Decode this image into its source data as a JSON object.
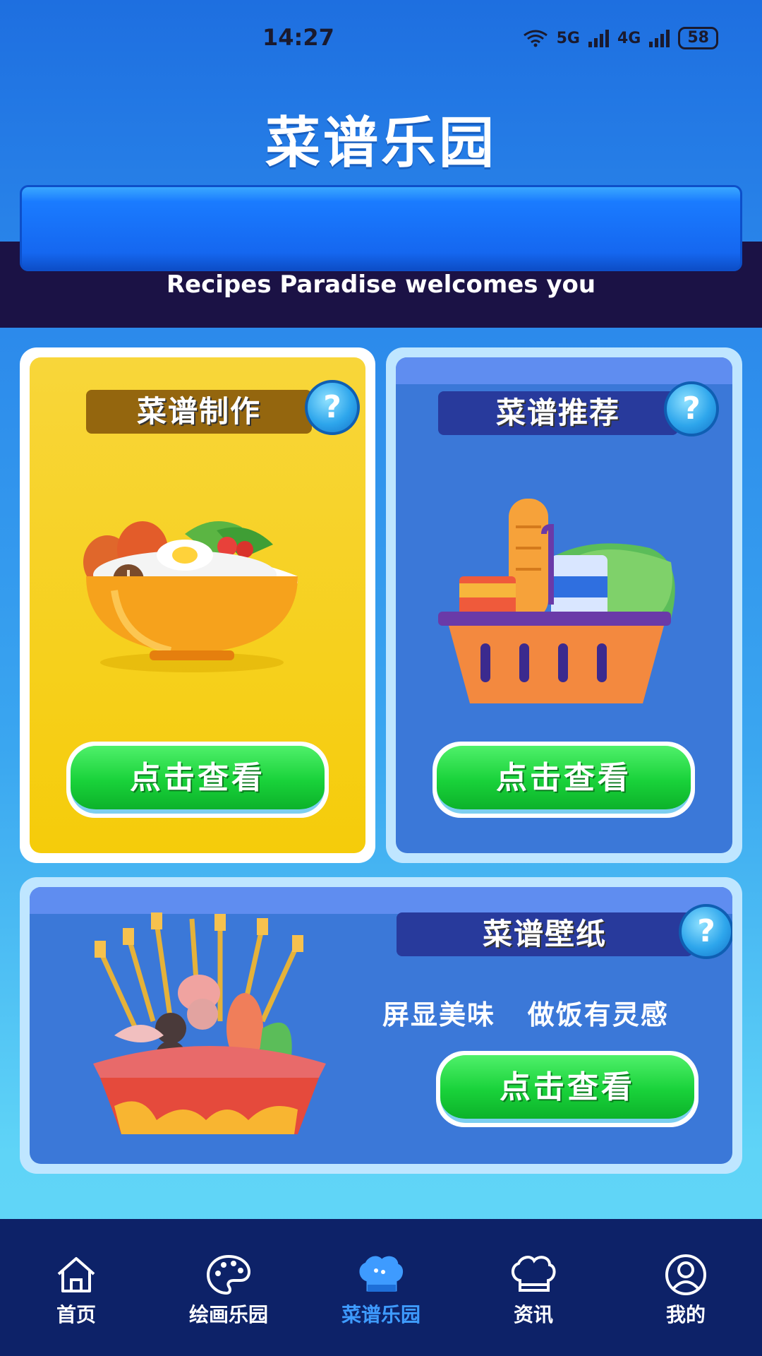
{
  "status_bar": {
    "time": "14:27",
    "network_5g": "5G",
    "network_4g": "4G",
    "battery": "58"
  },
  "app_title": "菜谱乐园",
  "welcome_text": "Recipes Paradise welcomes you",
  "cards": {
    "make": {
      "title": "菜谱制作",
      "help": "?",
      "button": "点击查看"
    },
    "recommend": {
      "title": "菜谱推荐",
      "help": "?",
      "button": "点击查看"
    },
    "wallpaper": {
      "title": "菜谱壁纸",
      "help": "?",
      "slogan": "屏显美味   做饭有灵感",
      "button": "点击查看"
    }
  },
  "bottom_nav": {
    "items": [
      {
        "label": "首页",
        "icon": "home-icon"
      },
      {
        "label": "绘画乐园",
        "icon": "palette-icon"
      },
      {
        "label": "菜谱乐园",
        "icon": "chef-hat-icon",
        "active": true
      },
      {
        "label": "资讯",
        "icon": "chef-hat-outline-icon"
      },
      {
        "label": "我的",
        "icon": "user-icon"
      }
    ]
  },
  "colors": {
    "accent": "#3e9bff",
    "nav_bg": "#0d2268",
    "button_green": "#19d23a",
    "card_yellow": "#f5cc0a",
    "card_blue": "#3b78d8"
  }
}
